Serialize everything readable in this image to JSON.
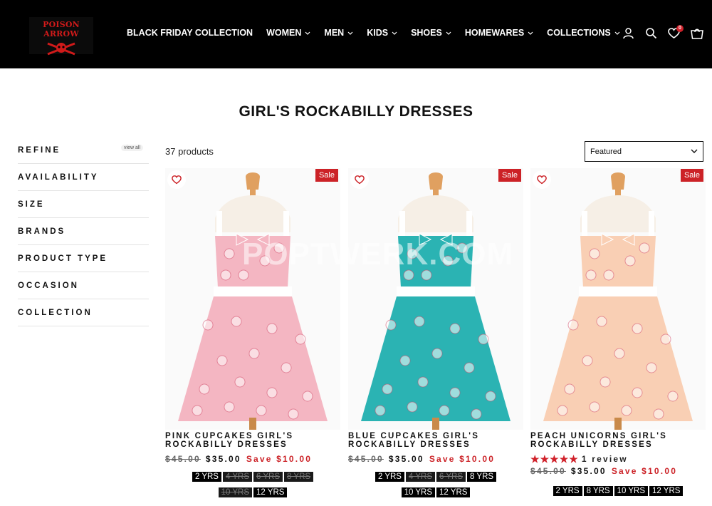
{
  "brand": {
    "name": "POISON ARROW"
  },
  "nav": {
    "items": [
      {
        "label": "BLACK FRIDAY COLLECTION",
        "dropdown": false
      },
      {
        "label": "WOMEN",
        "dropdown": true
      },
      {
        "label": "MEN",
        "dropdown": true
      },
      {
        "label": "KIDS",
        "dropdown": true
      },
      {
        "label": "SHOES",
        "dropdown": true
      },
      {
        "label": "HOMEWARES",
        "dropdown": true
      },
      {
        "label": "COLLECTIONS",
        "dropdown": true
      }
    ],
    "icons": [
      "account-icon",
      "search-icon",
      "wishlist-icon",
      "cart-icon"
    ],
    "wishlist_badge": "0"
  },
  "page": {
    "title": "GIRL'S ROCKABILLY DRESSES"
  },
  "sidebar": {
    "filters": [
      {
        "label": "REFINE",
        "extra": "view all"
      },
      {
        "label": "AVAILABILITY"
      },
      {
        "label": "SIZE"
      },
      {
        "label": "BRANDS"
      },
      {
        "label": "PRODUCT TYPE"
      },
      {
        "label": "OCCASION"
      },
      {
        "label": "COLLECTION"
      }
    ]
  },
  "toolbar": {
    "count": "37 products",
    "sort_value": "Featured"
  },
  "watermark": "POPTWERK.COM",
  "colors": {
    "sale": "#cc2227",
    "header_bg": "#000000",
    "star": "#d0212a"
  },
  "products": [
    {
      "title_line1": "PINK CUPCAKES GIRL'S",
      "title_line2": "ROCKABILLY DRESSES",
      "old_price": "$45.00",
      "price": "$35.00",
      "save": "Save $10.00",
      "sale_badge": "Sale",
      "dress_color": "#f4b6c2",
      "rating": null,
      "review_text": "",
      "sizes_row1": [
        {
          "label": "2 YRS",
          "available": true
        },
        {
          "label": "4 YRS",
          "available": false
        },
        {
          "label": "6 YRS",
          "available": false
        },
        {
          "label": "8 YRS",
          "available": false
        }
      ],
      "sizes_row2": [
        {
          "label": "10 YRS",
          "available": false
        },
        {
          "label": "12 YRS",
          "available": true
        }
      ]
    },
    {
      "title_line1": "BLUE CUPCAKES GIRL'S",
      "title_line2": "ROCKABILLY DRESSES",
      "old_price": "$45.00",
      "price": "$35.00",
      "save": "Save $10.00",
      "sale_badge": "Sale",
      "dress_color": "#2bb3b3",
      "rating": null,
      "review_text": "",
      "sizes_row1": [
        {
          "label": "2 YRS",
          "available": true
        },
        {
          "label": "4 YRS",
          "available": false
        },
        {
          "label": "6 YRS",
          "available": false
        },
        {
          "label": "8 YRS",
          "available": true
        }
      ],
      "sizes_row2": [
        {
          "label": "10 YRS",
          "available": true
        },
        {
          "label": "12 YRS",
          "available": true
        }
      ]
    },
    {
      "title_line1": "PEACH UNICORNS GIRL'S",
      "title_line2": "ROCKABILLY DRESSES",
      "old_price": "$45.00",
      "price": "$35.00",
      "save": "Save $10.00",
      "sale_badge": "Sale",
      "dress_color": "#f9cfb4",
      "rating": 5,
      "review_text": "1 review",
      "sizes_row1": [
        {
          "label": "2 YRS",
          "available": true
        },
        {
          "label": "8 YRS",
          "available": true
        },
        {
          "label": "10 YRS",
          "available": true
        },
        {
          "label": "12 YRS",
          "available": true
        }
      ],
      "sizes_row2": []
    }
  ]
}
